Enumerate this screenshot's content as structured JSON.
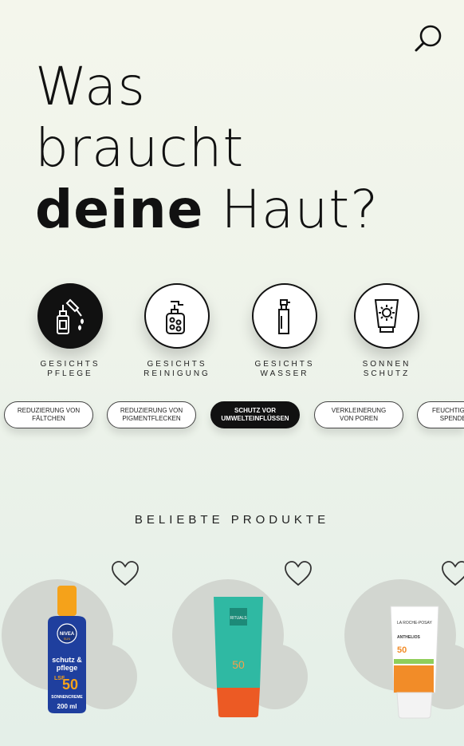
{
  "headline": {
    "line1": "Was",
    "line2": "braucht",
    "line3_bold": "deine",
    "line3_rest": " Haut?"
  },
  "search": {
    "icon": "search-icon"
  },
  "categories": [
    {
      "label": "GESICHTS\nPFLEGE",
      "icon": "dropper-bottle-icon",
      "active": true
    },
    {
      "label": "GESICHTS\nREINIGUNG",
      "icon": "pump-bottle-icon",
      "active": false
    },
    {
      "label": "GESICHTS\nWASSER",
      "icon": "spray-bottle-icon",
      "active": false
    },
    {
      "label": "SONNEN\nSCHUTZ",
      "icon": "sunscreen-tube-icon",
      "active": false
    }
  ],
  "filters": [
    {
      "label": "REDUZIERUNG VON\nFÄLTCHEN",
      "active": false
    },
    {
      "label": "REDUZIERUNG VON\nPIGMENTFLECKEN",
      "active": false
    },
    {
      "label": "SCHUTZ VOR\nUMWELTEINFLÜSSEN",
      "active": true
    },
    {
      "label": "VERKLEINERUNG\nVON POREN",
      "active": false
    },
    {
      "label": "FEUCHTIGKEITS\nSPENDEND",
      "active": false
    }
  ],
  "section_title": "BELIEBTE PRODUKTE",
  "products": [
    {
      "brand": "NIVEA",
      "sub": "SUN",
      "name": "schutz &\npflege",
      "lsf": "LSF",
      "spf": "50",
      "footer1": "SONNENCREME",
      "volume": "200 ml"
    },
    {
      "brand": "RITUALS",
      "spf": "50"
    },
    {
      "brand": "LA ROCHE-POSAY",
      "product": "ANTHELIOS",
      "spf": "50"
    }
  ],
  "colors": {
    "ink": "#111111",
    "blob": "#d2d6d0",
    "nivea_blue": "#1f3f9e",
    "nivea_orange": "#f5a21a",
    "rituals_teal": "#2fb9a3",
    "rituals_orange": "#ec5a24",
    "lrp_orange": "#f28c28"
  }
}
